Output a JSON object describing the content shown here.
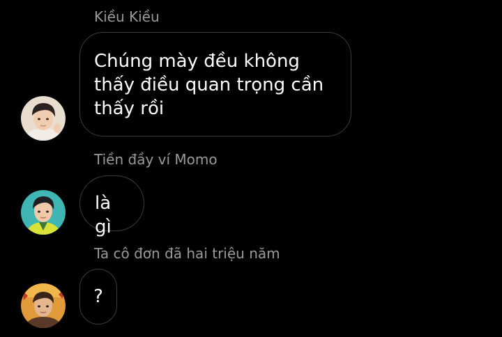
{
  "messages": [
    {
      "sender": "Kiều Kiều",
      "text_lines": [
        "Chúng mày đều không",
        "thấy điều quan trọng cần",
        "thấy rồi"
      ],
      "avatar_icon": "profile-photo-icon"
    },
    {
      "sender": "Tiền đầy ví Momo",
      "text_lines": [
        "là gì"
      ],
      "avatar_icon": "profile-photo-icon"
    },
    {
      "sender": "Ta cô đơn đã hai triệu năm",
      "text_lines": [
        "?"
      ],
      "avatar_icon": "profile-photo-icon"
    }
  ],
  "colors": {
    "background": "#000000",
    "bubble_border": "#3c3c3c",
    "sender_text": "#9a9a9a",
    "message_text": "#ffffff"
  }
}
